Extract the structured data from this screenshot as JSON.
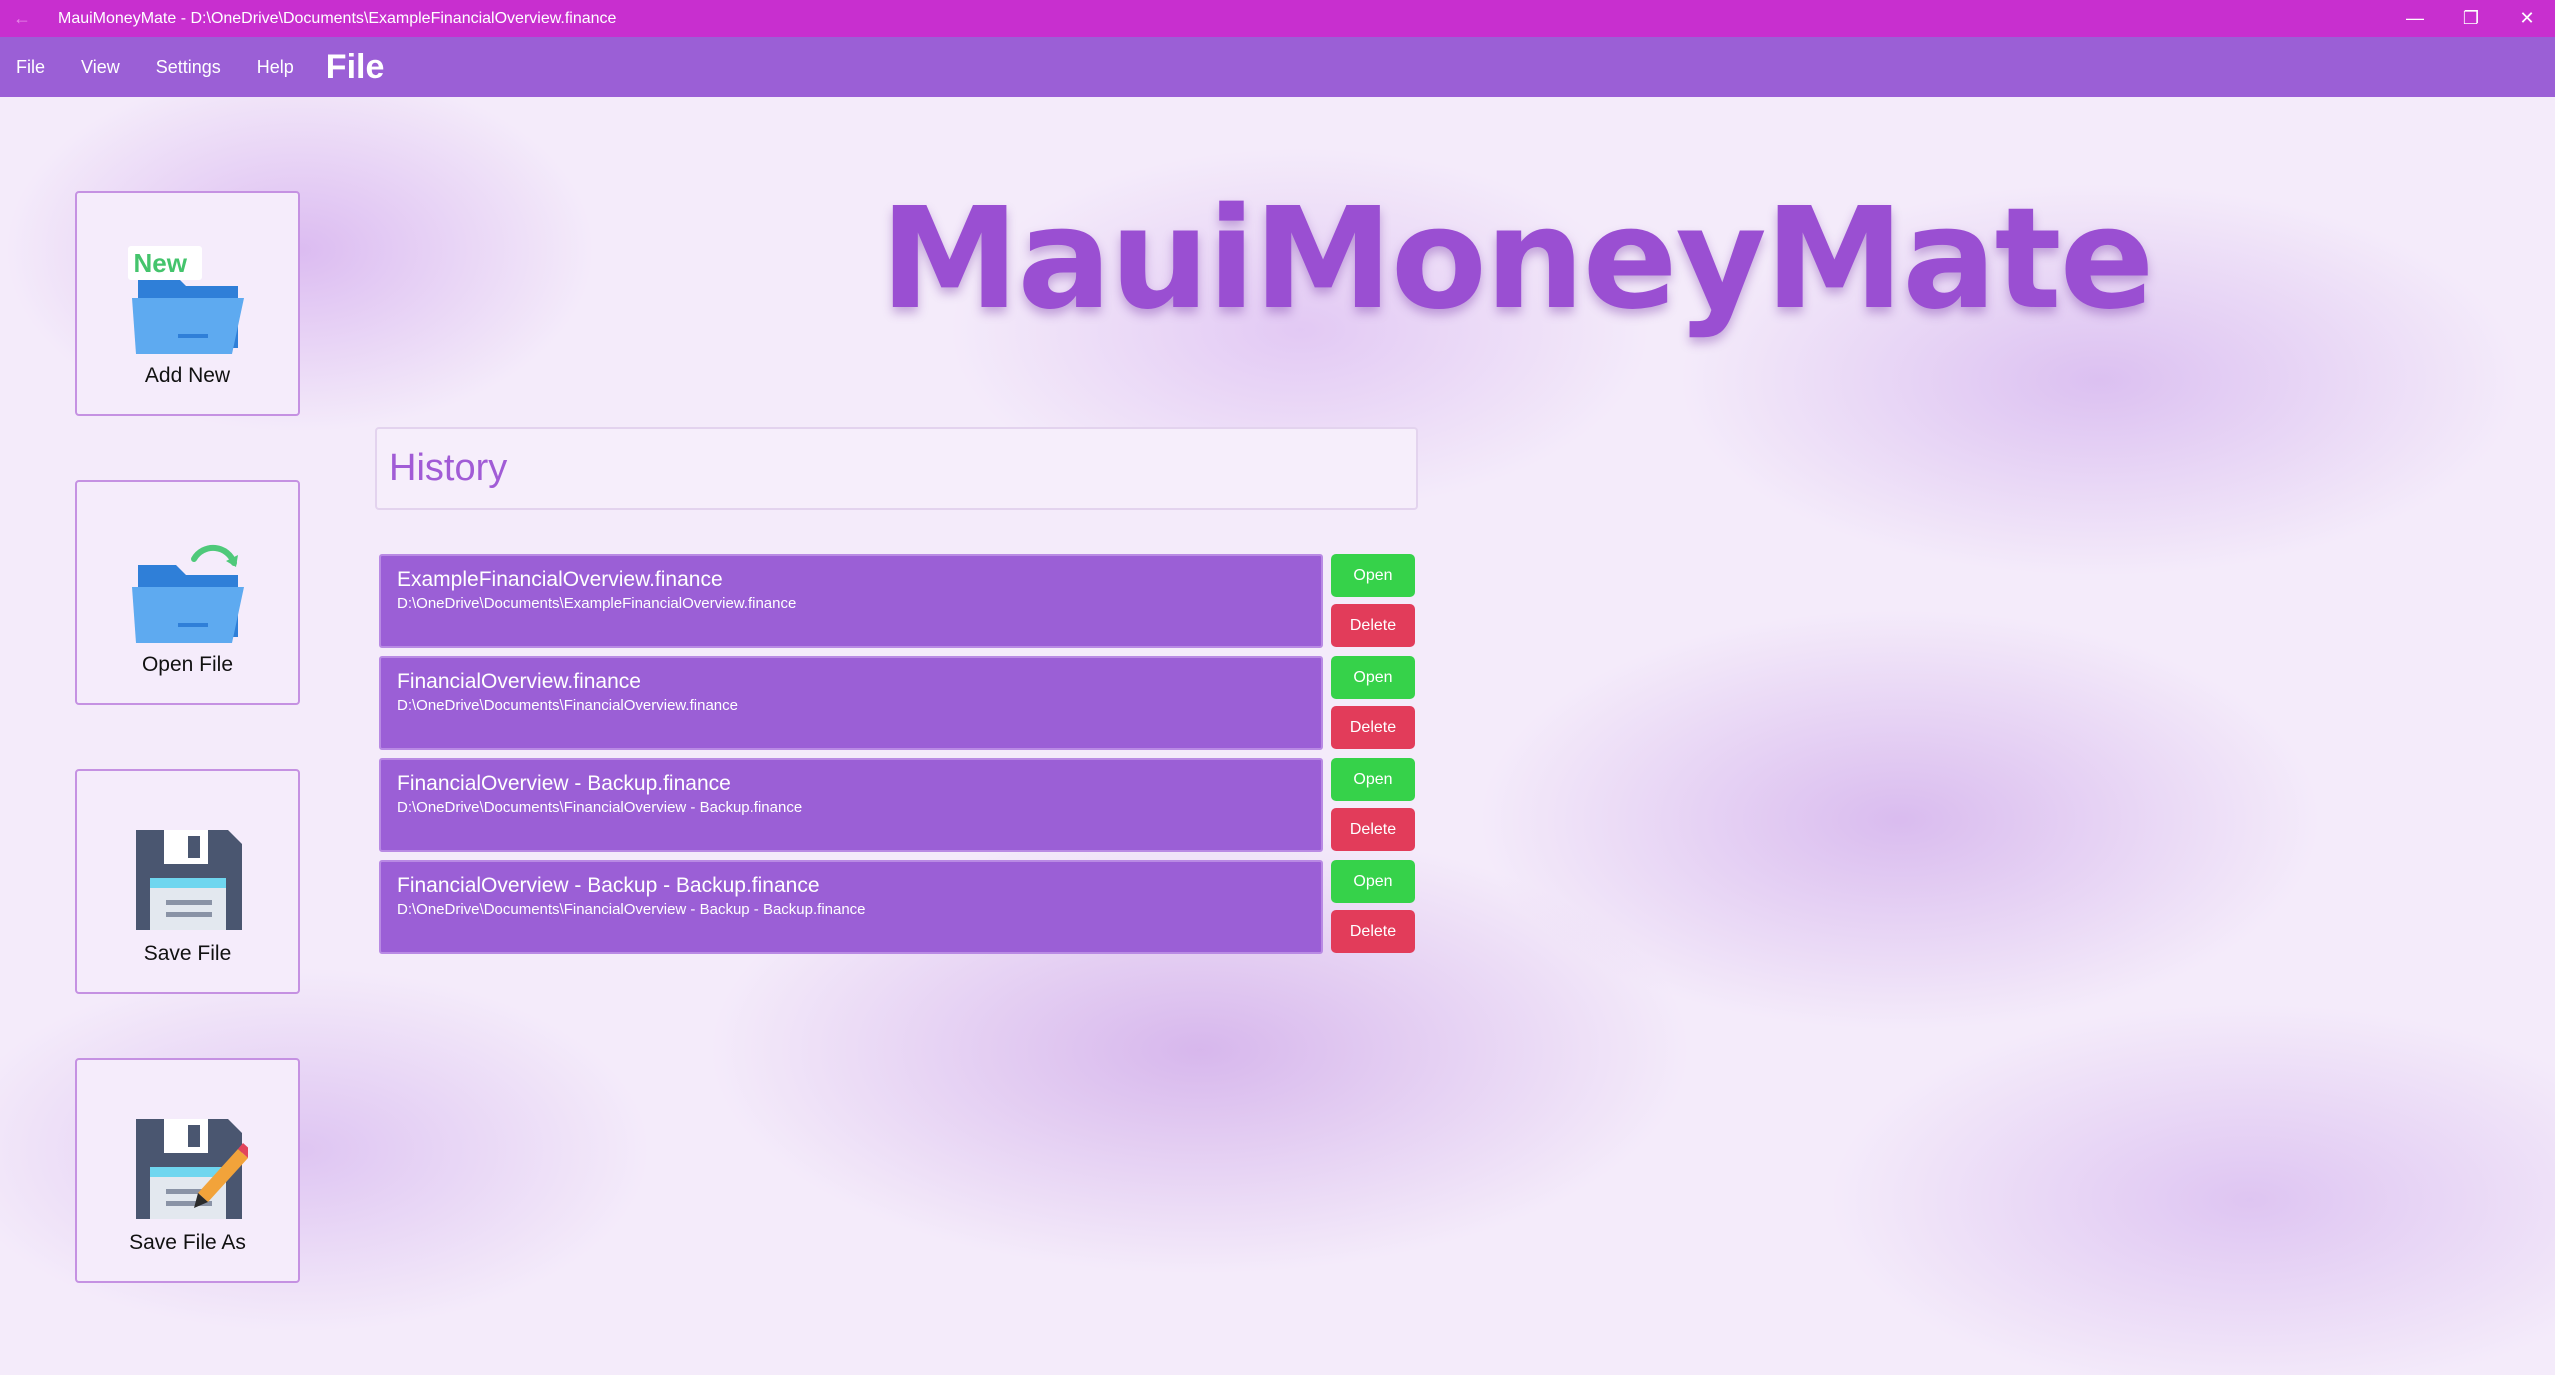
{
  "window": {
    "title": "MauiMoneyMate - D:\\OneDrive\\Documents\\ExampleFinancialOverview.finance",
    "back_glyph": "←",
    "minimize_glyph": "—",
    "restore_glyph": "❐",
    "close_glyph": "✕"
  },
  "menu": {
    "file": "File",
    "view": "View",
    "settings": "Settings",
    "help": "Help",
    "page_heading": "File"
  },
  "sidebar": {
    "add_new": {
      "label": "Add New",
      "badge": "New",
      "icon": "new-folder-icon"
    },
    "open_file": {
      "label": "Open File",
      "icon": "open-folder-icon"
    },
    "save_file": {
      "label": "Save File",
      "icon": "floppy-disk-icon"
    },
    "save_file_as": {
      "label": "Save File As",
      "icon": "floppy-disk-pencil-icon"
    }
  },
  "logo": {
    "text": "MauiMoneyMate"
  },
  "history": {
    "title": "History",
    "items": [
      {
        "name": "ExampleFinancialOverview.finance",
        "path": "D:\\OneDrive\\Documents\\ExampleFinancialOverview.finance",
        "open": "Open",
        "delete": "Delete"
      },
      {
        "name": "FinancialOverview.finance",
        "path": "D:\\OneDrive\\Documents\\FinancialOverview.finance",
        "open": "Open",
        "delete": "Delete"
      },
      {
        "name": "FinancialOverview - Backup.finance",
        "path": "D:\\OneDrive\\Documents\\FinancialOverview - Backup.finance",
        "open": "Open",
        "delete": "Delete"
      },
      {
        "name": "FinancialOverview - Backup - Backup.finance",
        "path": "D:\\OneDrive\\Documents\\FinancialOverview - Backup - Backup.finance",
        "open": "Open",
        "delete": "Delete"
      }
    ]
  },
  "colors": {
    "titlebar": "#c82fcf",
    "menubar": "#9b5fd6",
    "history_item": "#9b5fd6",
    "open_button": "#36d24a",
    "delete_button": "#e23c5a"
  }
}
